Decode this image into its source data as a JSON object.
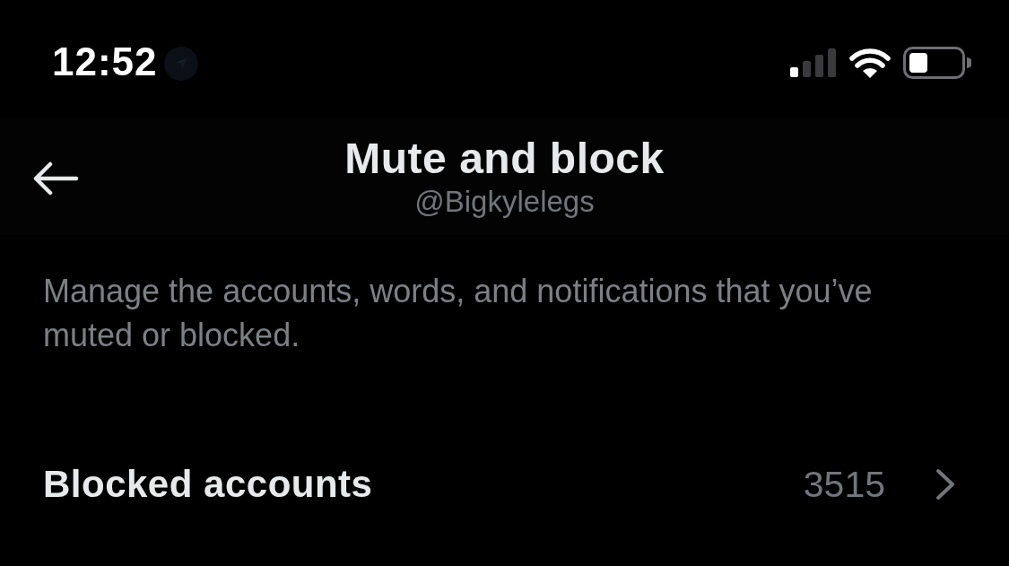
{
  "status_bar": {
    "time": "12:52"
  },
  "header": {
    "title": "Mute and block",
    "subtitle": "@Bigkylelegs"
  },
  "description": "Manage the accounts, words, and notifications that you’ve muted or blocked.",
  "settings": [
    {
      "label": "Blocked accounts",
      "value": "3515"
    }
  ]
}
